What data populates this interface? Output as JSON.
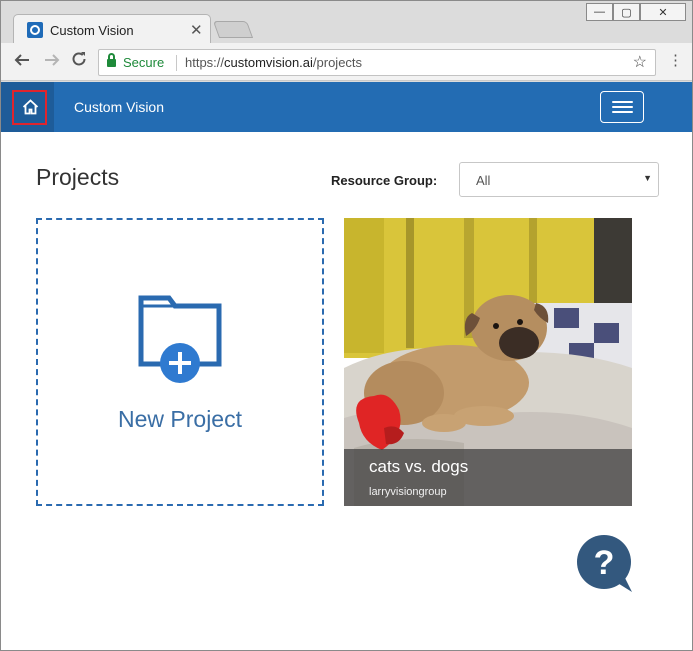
{
  "browser": {
    "tab_title": "Custom Vision",
    "tab_close": "✕",
    "window_controls": [
      "—",
      "▢",
      "✕"
    ],
    "secure_label": "Secure",
    "url_scheme": "https://",
    "url_domain": "customvision.ai",
    "url_path": "/projects",
    "icons": [
      "back-arrow-icon",
      "forward-arrow-icon",
      "reload-icon",
      "lock-icon",
      "star-icon",
      "menu-dots-icon"
    ]
  },
  "header": {
    "app_title": "Custom Vision",
    "background_color": "#236cb3",
    "icons": [
      "home-icon",
      "hamburger-menu-icon"
    ]
  },
  "page": {
    "title": "Projects",
    "resource_group_label": "Resource Group:",
    "resource_group_value": "All"
  },
  "new_project": {
    "label": "New Project",
    "icon": "folder-plus-icon"
  },
  "projects": [
    {
      "name": "cats vs. dogs",
      "group": "larryvisiongroup"
    }
  ],
  "help": {
    "icon": "help-bubble-icon",
    "glyph": "?"
  }
}
